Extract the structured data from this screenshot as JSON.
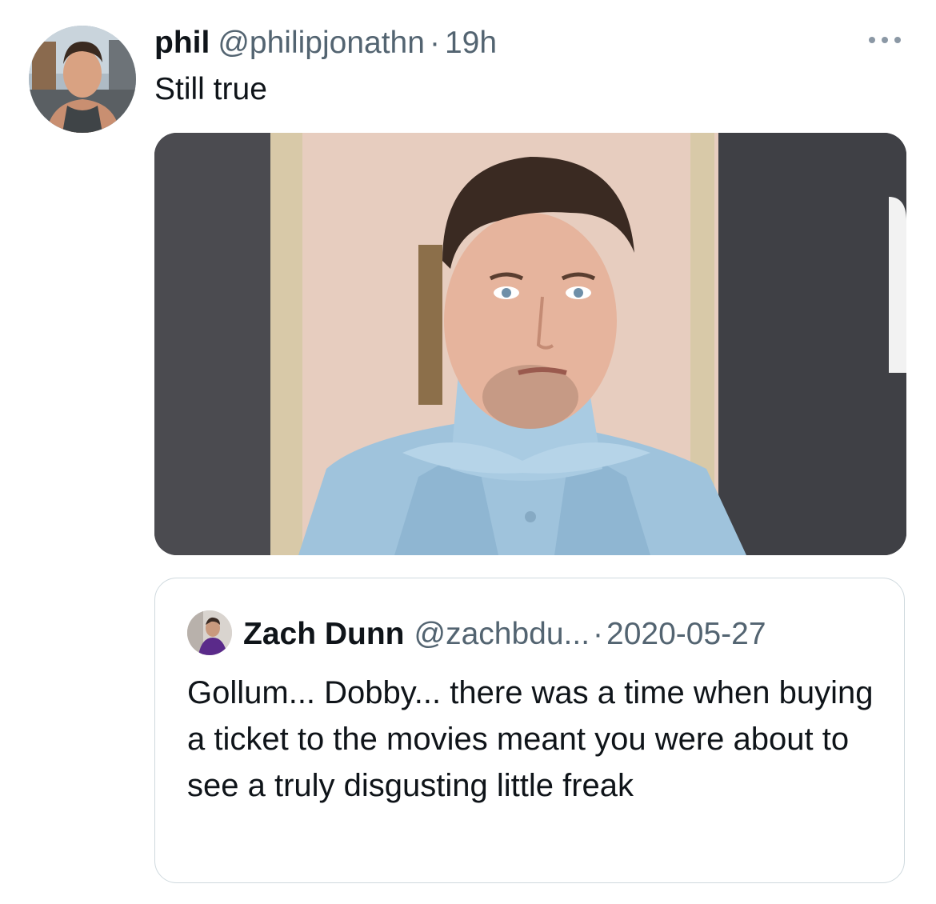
{
  "tweet": {
    "display_name": "phil",
    "handle": "@philipjonathn",
    "separator": "·",
    "time": "19h",
    "text": "Still true",
    "more_icon": "more-horizontal-icon"
  },
  "quote": {
    "display_name": "Zach Dunn",
    "handle": "@zachbdu...",
    "separator": "·",
    "date": "2020-05-27",
    "text": "Gollum... Dobby... there was a time when buying a ticket to the movies meant you were about to see a truly disgusting little freak"
  },
  "colors": {
    "text_primary": "#0f1419",
    "text_secondary": "#536471",
    "border": "#cfd9de",
    "suit_blue": "#9fc3dc"
  }
}
